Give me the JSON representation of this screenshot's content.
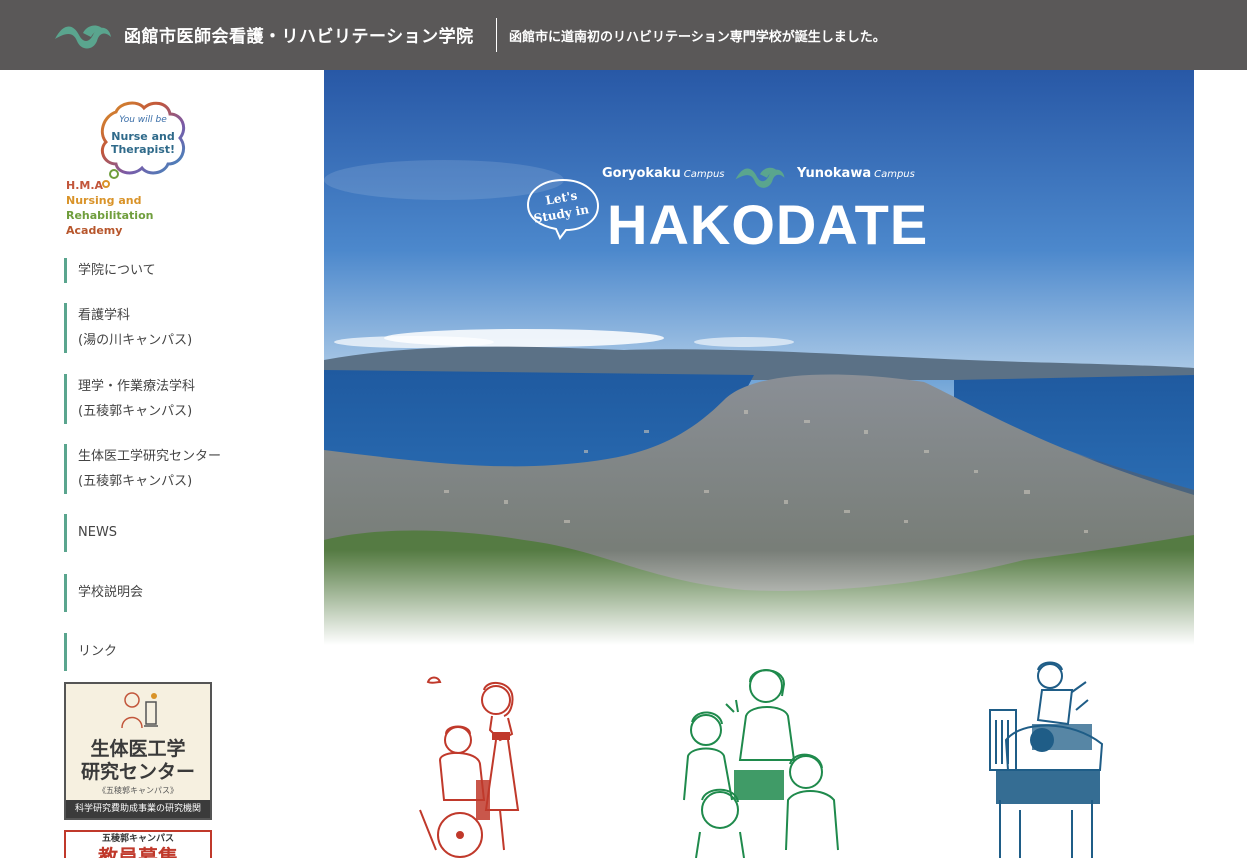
{
  "header": {
    "site_title": "函館市医師会看護・リハビリテーション学院",
    "tagline": "函館市に道南初のリハビリテーション専門学校が誕生しました。",
    "logo_icon": "wave-logo-icon",
    "logo_color": "#5aa58e"
  },
  "sidebar": {
    "bubble": {
      "line1": "You will be",
      "line2": "Nurse and",
      "line3": "Therapist!"
    },
    "academy": {
      "line1": "H.M.A",
      "line2": "Nursing and",
      "line3": "Rehabilitation",
      "line4": "Academy"
    },
    "nav": [
      {
        "label": "学院について"
      },
      {
        "label": "看護学科",
        "sub": "(湯の川キャンパス)"
      },
      {
        "label": "理学・作業療法学科",
        "sub": "(五稜郭キャンパス)"
      },
      {
        "label": "生体医工学研究センター",
        "sub": "(五稜郭キャンパス)"
      },
      {
        "label": "NEWS"
      },
      {
        "label": "学校説明会"
      },
      {
        "label": "リンク"
      }
    ],
    "banner1": {
      "title_line1": "生体医工学",
      "title_line2": "研究センター",
      "campus": "《五稜郭キャンパス》",
      "footer": "科学研究費助成事業の研究機関"
    },
    "banner2": {
      "top": "五稜郭キャンパス",
      "main": "教員募集"
    }
  },
  "hero": {
    "campus_left": "Goryokaku",
    "campus_left_sub": "Campus",
    "campus_right": "Yunokawa",
    "campus_right_sub": "Campus",
    "lets_line1": "Let's",
    "lets_line2": "Study in",
    "title": "HAKODATE"
  },
  "colors": {
    "header_bg": "#5a5858",
    "accent": "#5aa58e",
    "nursing_red": "#c0392b",
    "rehab_green": "#1f8a4c",
    "research_blue": "#1f5d87"
  }
}
